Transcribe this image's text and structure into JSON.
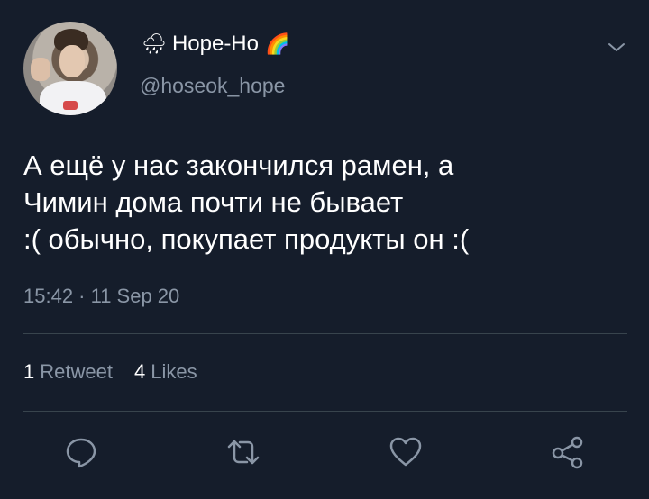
{
  "user": {
    "weather_emoji": "🌧",
    "display_name": "Hope-Ho",
    "rainbow_emoji": "🌈",
    "handle": "@hoseok_hope"
  },
  "tweet": {
    "text_lines": [
      "А ещё у нас закончился рамен, а",
      "Чимин дома почти не бывает",
      ":( обычно, покупает продукты он :("
    ],
    "timestamp": "15:42 · 11 Sep 20"
  },
  "stats": {
    "retweets_count": "1",
    "retweets_label": "Retweet",
    "likes_count": "4",
    "likes_label": "Likes"
  },
  "colors": {
    "background": "#151d2b",
    "text": "#ffffff",
    "secondary": "#8a96a6",
    "divider": "#38444d"
  },
  "icons": [
    "weather-emoji",
    "rainbow-emoji",
    "chevron-down-icon",
    "reply-icon",
    "retweet-icon",
    "like-icon",
    "share-icon"
  ]
}
